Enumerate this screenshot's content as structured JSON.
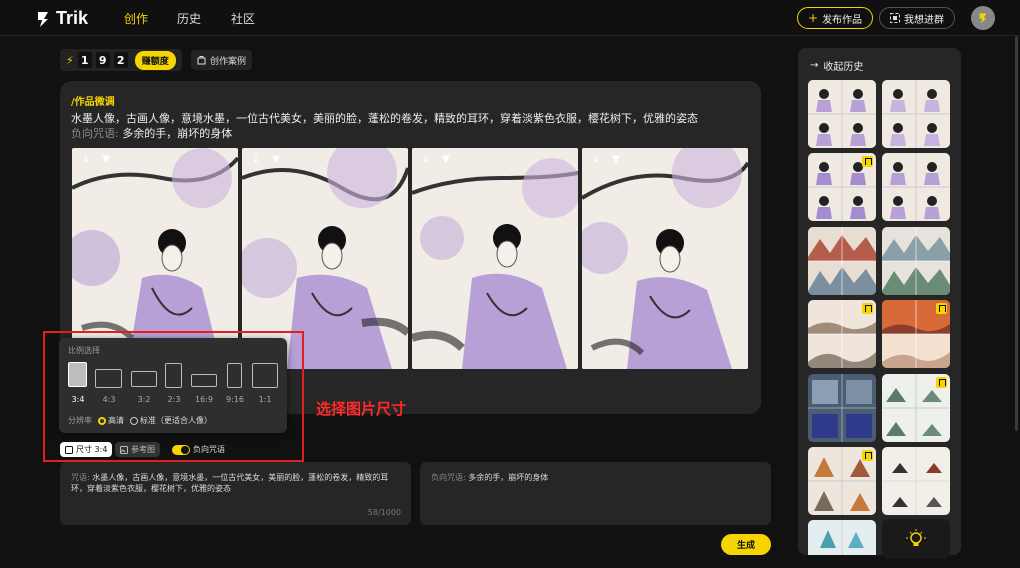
{
  "nav": {
    "brand": "Trik",
    "links": [
      "创作",
      "历史",
      "社区"
    ],
    "publish_label": "发布作品",
    "join_label": "我想进群"
  },
  "credits": {
    "digits": [
      "1",
      "9",
      "2"
    ],
    "earn_label": "赚额度",
    "cases_label": "创作案例"
  },
  "card": {
    "title": "/作品微调",
    "prompt": "水墨人像，古画人像，意境水墨，一位古代美女，美丽的脸，蓬松的卷发，精致的耳环，穿着淡紫色衣服，樱花树下，优雅的姿态",
    "negative_label": "负向咒语: ",
    "negative_text": "多余的手，崩坏的身体"
  },
  "ratio_popup": {
    "title": "比例选择",
    "ratios": [
      "3:4",
      "4:3",
      "3:2",
      "2:3",
      "16:9",
      "9:16",
      "1:1"
    ],
    "selected": "3:4",
    "resolution_label": "分辨率",
    "res_options": [
      "高清",
      "标准（更适合人像）"
    ],
    "res_selected": "高清"
  },
  "annotation": {
    "text": "选择图片尺寸"
  },
  "tools": {
    "size_label": "尺寸 3:4",
    "ref_label": "参考图",
    "neg_label": "负向咒语"
  },
  "input": {
    "prompt_label": "咒语: ",
    "prompt_text": "水墨人像，古画人像，意境水墨，一位古代美女，美丽的脸，蓬松的卷发，精致的耳环，穿着淡紫色衣服，樱花树下，优雅的姿态",
    "counter": "58/1000",
    "neg_label": "负向咒语: ",
    "neg_text": "多余的手，崩坏的身体"
  },
  "generate_label": "生成",
  "history": {
    "title": "收起历史"
  },
  "colors": {
    "accent": "#f5d400",
    "annotation": "#e02020",
    "background": "#111111",
    "panel": "#262626"
  }
}
